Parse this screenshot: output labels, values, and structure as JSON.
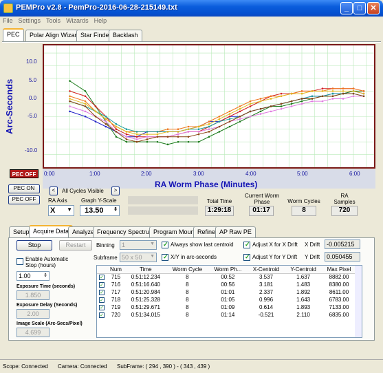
{
  "window": {
    "title": "PEMPro v2.8 - PemPro-2016-06-28-215149.txt"
  },
  "menu": [
    "File",
    "Settings",
    "Tools",
    "Wizards",
    "Help"
  ],
  "tabs": [
    "PEC",
    "Polar Align Wizard",
    "Star Finder",
    "Backlash"
  ],
  "chart": {
    "ylabel": "Arc-Seconds",
    "xlabel": "RA Worm Phase (Minutes)",
    "yticks": [
      "10.0",
      "5.0",
      "0.0",
      "-5.0",
      "-10.0"
    ],
    "xticks": [
      "0:00",
      "1:00",
      "2:00",
      "3:00",
      "4:00",
      "5:00",
      "6:00"
    ]
  },
  "chart_data": {
    "type": "line",
    "ylim": [
      -12,
      12
    ],
    "xlim": [
      0,
      6.4
    ],
    "x": [
      0.5,
      0.8,
      1.0,
      1.2,
      1.4,
      1.6,
      1.8,
      2.0,
      2.2,
      2.4,
      2.6,
      2.8,
      3.0,
      3.2,
      3.4,
      3.6,
      3.8,
      4.0,
      4.2,
      4.4,
      4.6,
      4.8,
      5.0,
      5.2,
      5.4,
      5.6,
      5.8,
      6.0,
      6.2
    ],
    "series": [
      {
        "color": "#2323c8",
        "values": [
          -1,
          -2,
          -3,
          -4,
          -5,
          -6,
          -6,
          -5,
          -5,
          -5,
          -5,
          -4.5,
          -4,
          -3,
          -3,
          -2,
          -2,
          -1,
          -0.5,
          0,
          0.5,
          1,
          1.5,
          2,
          2,
          2.5,
          2.5,
          3,
          2.5
        ]
      },
      {
        "color": "#1c7a1c",
        "values": [
          5,
          3,
          0,
          -3,
          -6,
          -7,
          -7,
          -7,
          -7,
          -7.5,
          -7,
          -7,
          -7,
          -6,
          -5,
          -4,
          -3,
          -2,
          -1,
          0,
          0,
          0.5,
          1,
          1.5,
          2,
          2,
          2.5,
          3,
          3
        ]
      },
      {
        "color": "#d22020",
        "values": [
          3,
          2,
          0,
          -2,
          -4.5,
          -5.5,
          -6,
          -6,
          -6,
          -6,
          -5.5,
          -5,
          -5,
          -4,
          -3,
          -2,
          -1,
          0,
          1,
          2,
          2.5,
          2.5,
          3,
          3,
          3.5,
          3.5,
          3.5,
          3.5,
          3
        ]
      },
      {
        "color": "#f07820",
        "values": [
          2,
          1,
          -1,
          -2.5,
          -4,
          -5,
          -5,
          -5,
          -5,
          -4.5,
          -4.5,
          -4,
          -4,
          -3,
          -2,
          -1,
          0,
          1,
          1.5,
          2,
          2,
          2.5,
          3,
          3,
          3,
          3.5,
          3.5,
          3.5,
          3
        ]
      },
      {
        "color": "#e07ce0",
        "values": [
          0,
          -1,
          -2,
          -3,
          -5,
          -6,
          -6.5,
          -6,
          -6,
          -6,
          -5.5,
          -5,
          -5,
          -4.5,
          -4,
          -3,
          -2.5,
          -2,
          -1.5,
          -1,
          -0.5,
          0,
          0.5,
          1,
          1,
          1.5,
          1.5,
          2,
          2
        ]
      },
      {
        "color": "#1f9f9f",
        "values": [
          1,
          0,
          -1,
          -2,
          -3.5,
          -4.5,
          -5,
          -5,
          -5,
          -5,
          -5,
          -4.5,
          -4.5,
          -4,
          -3,
          -2.5,
          -2,
          -1,
          -0.5,
          0,
          0.5,
          1,
          1.5,
          2,
          2,
          2.5,
          2.5,
          2.5,
          2
        ]
      },
      {
        "color": "#8b4513",
        "values": [
          1,
          0,
          -2,
          -3.5,
          -5,
          -6.5,
          -7,
          -6.5,
          -6,
          -6,
          -6,
          -6,
          -5.5,
          -5,
          -4,
          -3,
          -2,
          -1,
          -0.5,
          0,
          0.5,
          1,
          1.5,
          1.5,
          2,
          2,
          2.5,
          2.5,
          2
        ]
      },
      {
        "color": "#e3b820",
        "values": [
          1.5,
          0.5,
          -1,
          -2.5,
          -4,
          -5,
          -5.5,
          -5.5,
          -5.5,
          -5,
          -5,
          -4.5,
          -4,
          -3.5,
          -2.5,
          -1.5,
          -0.5,
          0.5,
          1,
          1.5,
          2,
          2.5,
          2.5,
          3,
          3,
          3,
          3,
          3,
          2.5
        ]
      }
    ]
  },
  "pec": {
    "status": "PEC OFF",
    "on_btn": "PEC ON",
    "off_btn": "PEC OFF"
  },
  "cycles": {
    "label": "All Cycles Visible",
    "prev": "<",
    "next": ">"
  },
  "ra_axis": {
    "label": "RA Axis",
    "value": "X"
  },
  "yscale": {
    "label": "Graph Y-Scale",
    "value": "13.50"
  },
  "stats": [
    {
      "label": "Total Time",
      "value": "1:29:18"
    },
    {
      "label": "Current Worm Phase",
      "value": "01:17"
    },
    {
      "label": "Worm Cycles",
      "value": "8"
    },
    {
      "label": "RA Samples",
      "value": "720"
    }
  ],
  "subtabs": [
    "Setup",
    "Acquire Data",
    "Analyze",
    "Frequency Spectrum",
    "Program Mount",
    "Refine",
    "AP Raw PE"
  ],
  "acquire": {
    "stop": "Stop",
    "restart": "Restart",
    "auto_stop": "Enable Automatic Stop (hours)",
    "auto_stop_value": "1.00",
    "exposure_time_label": "Exposure Time (seconds)",
    "exposure_time": "1.850",
    "exposure_delay_label": "Exposure Delay (Seconds)",
    "exposure_delay": "2.00",
    "image_scale_label": "Image Scale (Arc-Secs/Pixel)",
    "image_scale": "4.699",
    "binning_label": "Binning",
    "binning": "1",
    "subframe_label": "Subframe",
    "subframe": "50 x 50",
    "always_centroid": "Always show last centroid",
    "xy_arcsec": "X/Y in arc-seconds",
    "adj_x": "Adjust X for X Drift",
    "adj_y": "Adjust Y for Y Drift",
    "xdrift_label": "X Drift",
    "xdrift": "-0.005215",
    "ydrift_label": "Y Drift",
    "ydrift": "0.050455"
  },
  "table": {
    "headers": [
      "Num",
      "Time",
      "Worm Cycle",
      "Worm Ph...",
      "X-Centroid",
      "Y-Centroid",
      "Max Pixel"
    ],
    "rows": [
      [
        "715",
        "0:51:12.234",
        "8",
        "00:52",
        "3.537",
        "1.637",
        "8882.00"
      ],
      [
        "716",
        "0:51:16.640",
        "8",
        "00:56",
        "3.181",
        "1.483",
        "8380.00"
      ],
      [
        "717",
        "0:51:20.984",
        "8",
        "01:01",
        "2.337",
        "1.892",
        "8611.00"
      ],
      [
        "718",
        "0:51:25.328",
        "8",
        "01:05",
        "0.996",
        "1.643",
        "6783.00"
      ],
      [
        "719",
        "0:51:29.671",
        "8",
        "01:09",
        "0.614",
        "1.893",
        "7133.00"
      ],
      [
        "720",
        "0:51:34.015",
        "8",
        "01:14",
        "-0.521",
        "2.110",
        "6835.00"
      ]
    ]
  },
  "status": {
    "scope": "Scope: Connected",
    "camera": "Camera: Connected",
    "subframe": "SubFrame: ( 294 , 390 ) - ( 343 , 439 )"
  }
}
